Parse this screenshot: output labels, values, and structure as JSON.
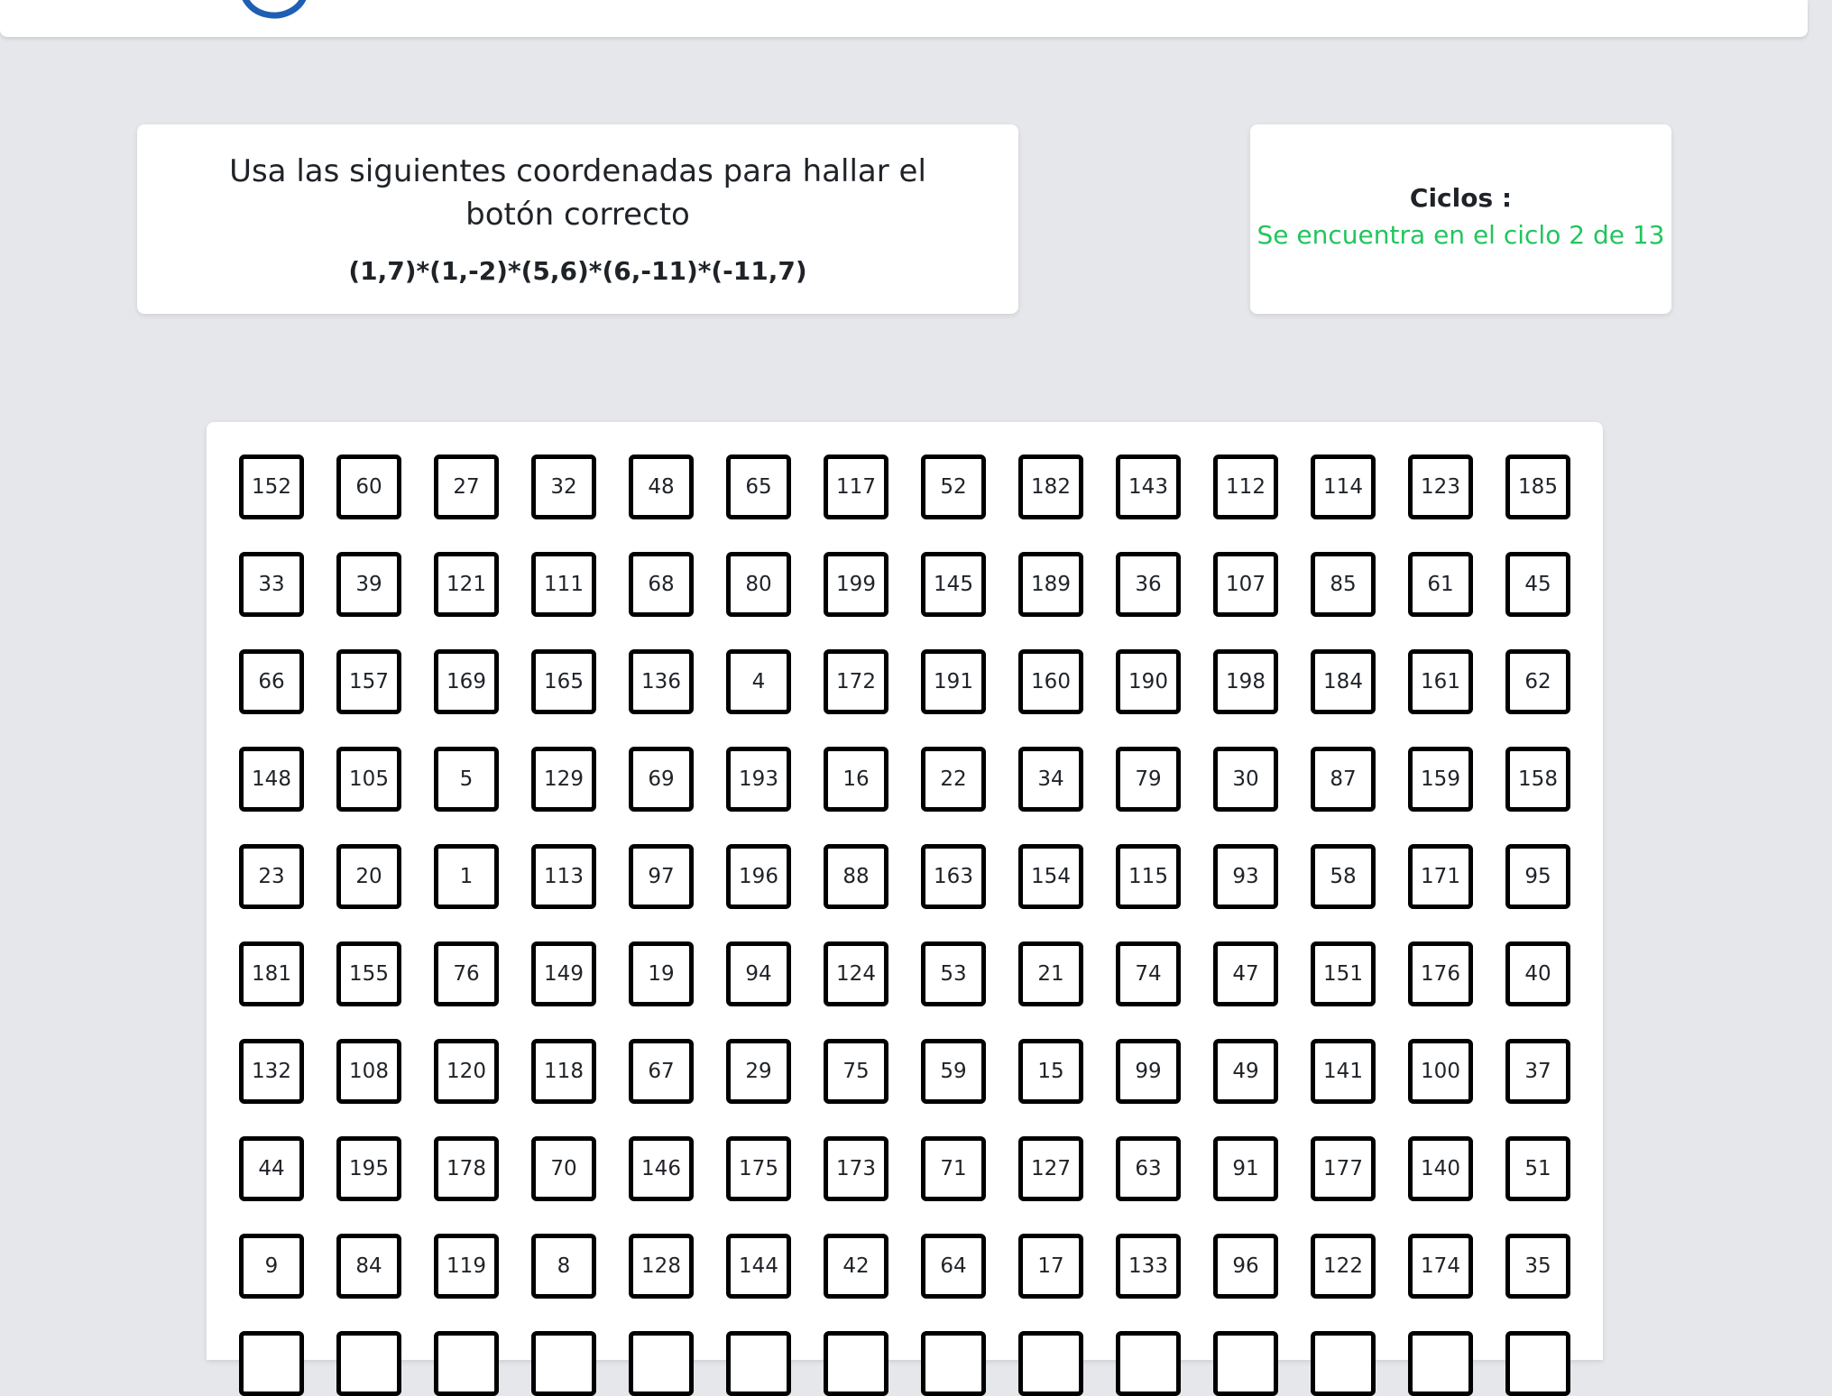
{
  "instructions": {
    "text": "Usa las siguientes coordenadas para hallar el botón correcto",
    "coordinates": "(1,7)*(1,-2)*(5,6)*(6,-11)*(-11,7)"
  },
  "cycles": {
    "title": "Ciclos :",
    "status": "Se encuentra en el ciclo 2 de 13",
    "status_color": "#22c55e"
  },
  "brand": {
    "logo_icon": "logo-icon",
    "logo_color": "#1e5fb3"
  },
  "grid": {
    "rows": [
      [
        "152",
        "60",
        "27",
        "32",
        "48",
        "65",
        "117",
        "52",
        "182",
        "143",
        "112",
        "114",
        "123",
        "185"
      ],
      [
        "33",
        "39",
        "121",
        "111",
        "68",
        "80",
        "199",
        "145",
        "189",
        "36",
        "107",
        "85",
        "61",
        "45"
      ],
      [
        "66",
        "157",
        "169",
        "165",
        "136",
        "4",
        "172",
        "191",
        "160",
        "190",
        "198",
        "184",
        "161",
        "62"
      ],
      [
        "148",
        "105",
        "5",
        "129",
        "69",
        "193",
        "16",
        "22",
        "34",
        "79",
        "30",
        "87",
        "159",
        "158"
      ],
      [
        "23",
        "20",
        "1",
        "113",
        "97",
        "196",
        "88",
        "163",
        "154",
        "115",
        "93",
        "58",
        "171",
        "95"
      ],
      [
        "181",
        "155",
        "76",
        "149",
        "19",
        "94",
        "124",
        "53",
        "21",
        "74",
        "47",
        "151",
        "176",
        "40"
      ],
      [
        "132",
        "108",
        "120",
        "118",
        "67",
        "29",
        "75",
        "59",
        "15",
        "99",
        "49",
        "141",
        "100",
        "37"
      ],
      [
        "44",
        "195",
        "178",
        "70",
        "146",
        "175",
        "173",
        "71",
        "127",
        "63",
        "91",
        "177",
        "140",
        "51"
      ],
      [
        "9",
        "84",
        "119",
        "8",
        "128",
        "144",
        "42",
        "64",
        "17",
        "133",
        "96",
        "122",
        "174",
        "35"
      ],
      [
        "",
        "",
        "",
        "",
        "",
        "",
        "",
        "",
        "",
        "",
        "",
        "",
        "",
        ""
      ]
    ]
  }
}
